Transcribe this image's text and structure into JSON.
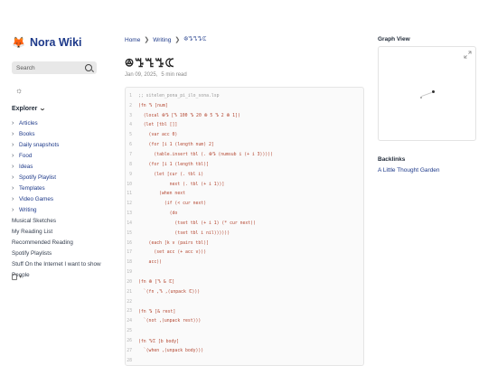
{
  "site": {
    "logo_icon": "fox-icon",
    "name": "Nora Wiki"
  },
  "search": {
    "placeholder": "Search"
  },
  "theme_toggle": {
    "icon": "sun-icon"
  },
  "explorer": {
    "title": "Explorer",
    "folders": [
      {
        "label": "Articles"
      },
      {
        "label": "Books"
      },
      {
        "label": "Daily snapshots"
      },
      {
        "label": "Food"
      },
      {
        "label": "Ideas"
      },
      {
        "label": "Spotify Playlist"
      },
      {
        "label": "Templates"
      },
      {
        "label": "Video Games"
      },
      {
        "label": "Writing"
      }
    ],
    "files": [
      {
        "label": "Musical Sketches"
      },
      {
        "label": "My Reading List"
      },
      {
        "label": "Recommended Reading"
      },
      {
        "label": "Spotify Playlists"
      },
      {
        "label": "Stuff On the Internet I want to show"
      },
      {
        "label": "People"
      }
    ]
  },
  "breadcrumbs": [
    "Home",
    "Writing",
    "ꔮꔤꔎꔤꕆ"
  ],
  "page": {
    "title": "ꔮꔤꔎꔤꕆ",
    "date": "Jan 09, 2025,",
    "read_time": "5 min read"
  },
  "code_lines": [
    ";; sitelen_pona_pi_ilo_sona.lsp",
    "(fn ꔎ [num]",
    "  (local ꔮꔤ [ꔎ 100 ꔤ 20 ꔮ 5 ꔤ 2 ꔮ 1])",
    "  (let [tbl []]",
    "    (var acc 0)",
    "    (for [i 1 (length num) 2]",
    "      (table.insert tbl (. ꔮꔤ (numsub i (+ i 3)))))",
    "    (for [i 1 (length tbl)]",
    "      (let [cur (. tbl i)",
    "            next (. tbl (+ i 1))]",
    "        (when next",
    "          (if (< cur next)",
    "            (do",
    "              (tset tbl (+ i 1) (* cur next))",
    "              (tset tbl i nil))))))",
    "    (each [k v (pairs tbl)]",
    "      (set acc (+ acc v)))",
    "    acc))",
    "",
    "(fn ꔮ [ꔎ & ꕆ]",
    "  `(fn ,ꔎ ,(unpack ꕆ)))",
    "",
    "(fn ꔤ [& rest]",
    "  `(not ,(unpack rest)))",
    "",
    "(fn ꔎꕆ [b body]",
    "  `(when ,(unpack body)))",
    ""
  ],
  "graph": {
    "title": "Graph View",
    "expand_icon": "expand-icon"
  },
  "backlinks": {
    "title": "Backlinks",
    "items": [
      "A Little Thought Garden"
    ]
  },
  "reader_mode": {
    "icon": "reader-mode-icon"
  },
  "colors": {
    "accent": "#1e3a8a",
    "logo": "#e07a2e",
    "code_text": "#b3452f"
  }
}
